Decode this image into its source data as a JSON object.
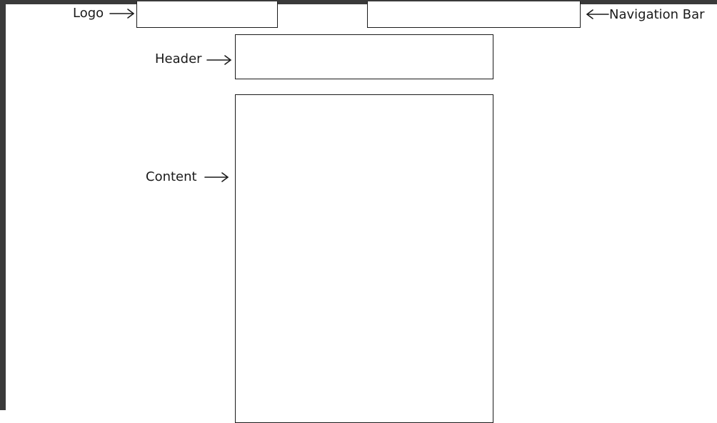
{
  "diagram": {
    "labels": {
      "logo": "Logo",
      "navigation": "Navigation Bar",
      "header": "Header",
      "content": "Content"
    },
    "colors": {
      "frame": "#3a3a3a",
      "canvas": "#ffffff",
      "stroke": "#1a1a1a"
    }
  }
}
